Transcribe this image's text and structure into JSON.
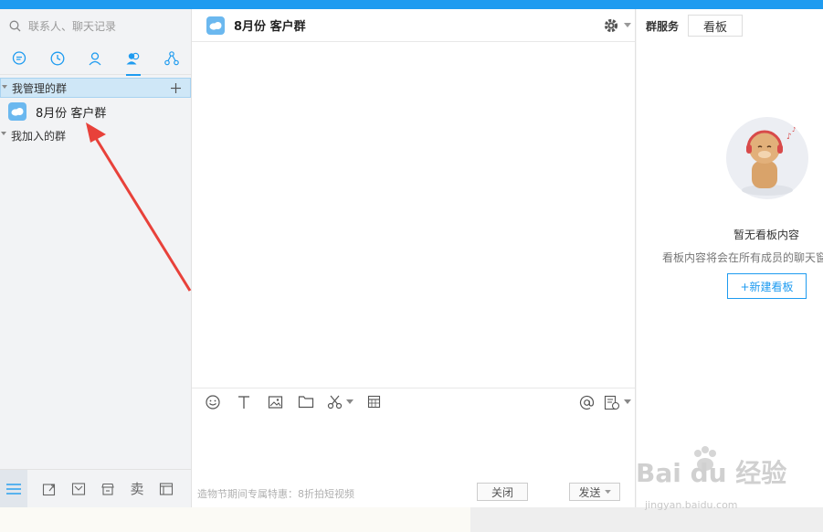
{
  "search": {
    "placeholder": "联系人、聊天记录"
  },
  "nav_tabs": [
    {
      "icon": "chat-bubble-icon"
    },
    {
      "icon": "clock-icon"
    },
    {
      "icon": "person-icon"
    },
    {
      "icon": "group-icon",
      "active": true
    },
    {
      "icon": "org-tree-icon"
    }
  ],
  "groups": {
    "managed_label": "我管理的群",
    "managed_items": [
      {
        "name": "8月份 客户群"
      }
    ],
    "joined_label": "我加入的群"
  },
  "left_bottom": {
    "sell_label": "卖"
  },
  "chat": {
    "title": "8月份 客户群",
    "promo": "造物节期间专属特惠：8折拍短视频",
    "close_label": "关闭",
    "send_label": "发送"
  },
  "right_panel": {
    "title": "群服务",
    "tab_label": "看板",
    "empty_title": "暂无看板内容",
    "empty_desc": "看板内容将会在所有成员的聊天窗",
    "new_board_label": "+新建看板"
  },
  "watermark": {
    "main": "Bai du 经验",
    "sub": "jingyan.baidu.com"
  },
  "colors": {
    "accent": "#1e9bf0",
    "arrow": "#e8413a"
  }
}
